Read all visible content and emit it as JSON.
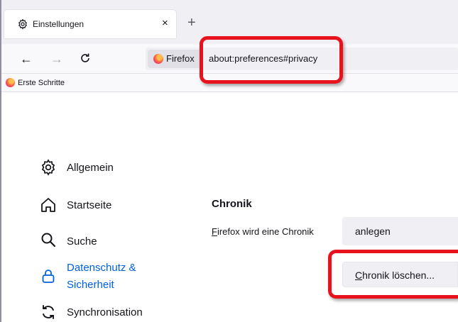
{
  "tab": {
    "title": "Einstellungen",
    "close": "×",
    "icon": "gear-icon"
  },
  "new_tab": "+",
  "nav": {
    "back": "←",
    "forward": "→",
    "reload": "C",
    "identity_label": "Firefox",
    "url": "about:preferences#privacy"
  },
  "bookmarks": [
    {
      "label": "Erste Schritte",
      "icon": "firefox-icon"
    }
  ],
  "sidebar": {
    "items": [
      {
        "label": "Allgemein",
        "icon": "gear-icon",
        "selected": false
      },
      {
        "label": "Startseite",
        "icon": "home-icon",
        "selected": false
      },
      {
        "label": "Suche",
        "icon": "search-icon",
        "selected": false
      },
      {
        "label_line1": "Datenschutz &",
        "label_line2": "Sicherheit",
        "icon": "lock-icon",
        "selected": true
      },
      {
        "label": "Synchronisation",
        "icon": "sync-icon",
        "selected": false
      }
    ]
  },
  "history": {
    "heading": "Chronik",
    "label_accesskey": "F",
    "label_rest": "irefox wird eine Chronik",
    "select_value": "anlegen",
    "clear_button_accesskey": "C",
    "clear_button_rest": "hronik löschen..."
  },
  "colors": {
    "accent": "#0061e0",
    "highlight": "#e8121c"
  }
}
